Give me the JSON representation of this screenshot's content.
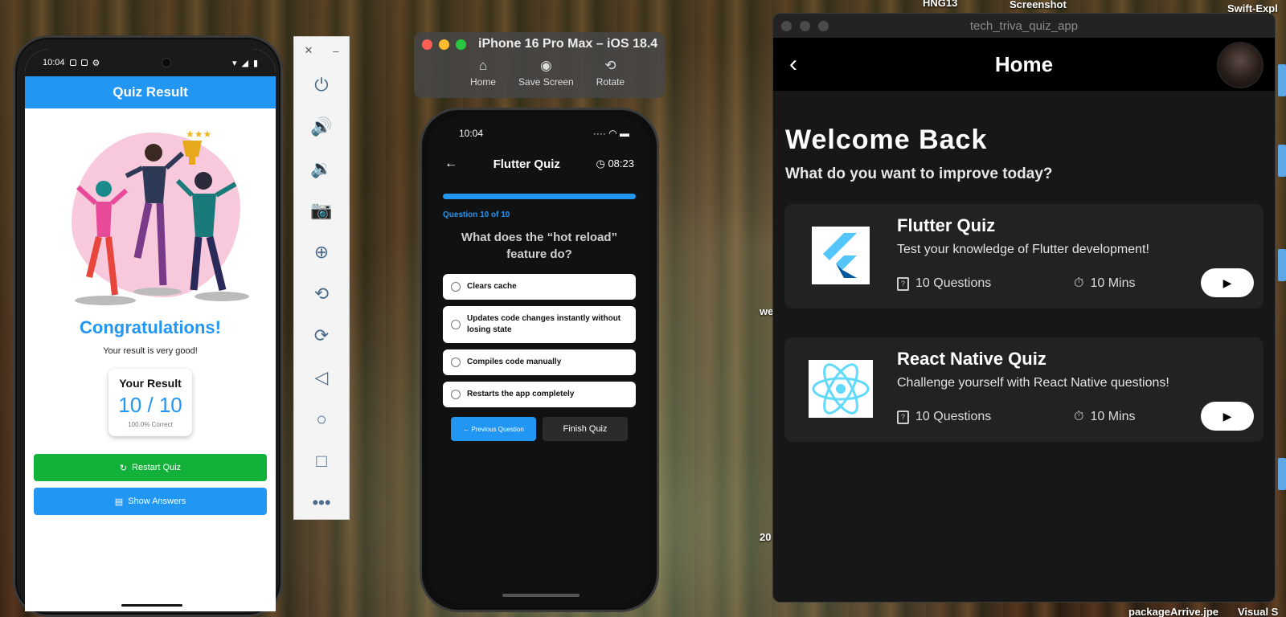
{
  "desktop": {
    "labels": [
      "HNG13",
      "Screenshot",
      "Swift-Expl",
      "we",
      "20",
      "packageArrive.jpe",
      "Visual S"
    ]
  },
  "android": {
    "status_time": "10:04",
    "appbar_title": "Quiz Result",
    "congrats": "Congratulations!",
    "subtitle": "Your result is very good!",
    "result_title": "Your Result",
    "score": "10 / 10",
    "percent": "100.0% Correct",
    "restart_label": "Restart Quiz",
    "show_answers_label": "Show Answers"
  },
  "emulator_toolbar": {
    "buttons": [
      "close",
      "minimize",
      "power",
      "volume-up",
      "volume-down",
      "camera",
      "zoom",
      "rotate-left",
      "rotate-right",
      "back",
      "home",
      "overview",
      "more"
    ]
  },
  "ios_sim": {
    "title": "iPhone 16 Pro Max – iOS 18.4",
    "tools": [
      "Home",
      "Save Screen",
      "Rotate"
    ],
    "status_time": "10:04",
    "quiz_title": "Flutter Quiz",
    "timer": "08:23",
    "progress": 1.0,
    "question_number": "Question 10 of 10",
    "question_text": "What does the “hot reload” feature do?",
    "options": [
      "Clears cache",
      "Updates code changes instantly without losing state",
      "Compiles code manually",
      "Restarts the app completely"
    ],
    "prev_label": "Previous Question",
    "finish_label": "Finish Quiz"
  },
  "mac_app": {
    "window_title": "tech_triva_quiz_app",
    "page_title": "Home",
    "welcome": "Welcome Back",
    "question": "What do you want to improve today?",
    "quizzes": [
      {
        "title": "Flutter Quiz",
        "description": "Test your knowledge of Flutter development!",
        "questions": "10 Questions",
        "duration": "10 Mins"
      },
      {
        "title": "React Native Quiz",
        "description": "Challenge yourself with React Native questions!",
        "questions": "10 Questions",
        "duration": "10 Mins"
      }
    ]
  },
  "colors": {
    "accent_blue": "#2196f3",
    "success_green": "#12b23a",
    "dark_bg": "#171717"
  }
}
